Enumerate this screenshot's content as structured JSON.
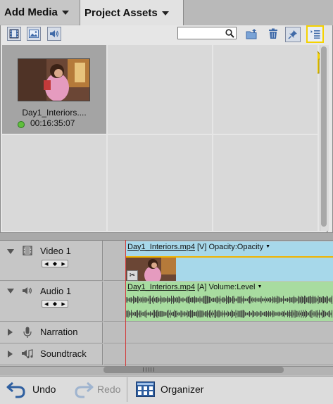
{
  "tabs": {
    "add_media": "Add Media",
    "project_assets": "Project Assets"
  },
  "toolbar": {
    "search_placeholder": ""
  },
  "assets": [
    {
      "name": "Day1_Interiors....",
      "duration": "00:16:35:07"
    }
  ],
  "timeline": {
    "tracks": [
      {
        "name": "Video 1"
      },
      {
        "name": "Audio 1"
      },
      {
        "name": "Narration"
      },
      {
        "name": "Soundtrack"
      }
    ],
    "video_clip": {
      "file": "Day1_Interiors.mp4",
      "tag": "[V]",
      "effect": "Opacity:Opacity"
    },
    "audio_clip": {
      "file": "Day1_Interiors.mp4",
      "tag": "[A]",
      "effect": "Volume:Level"
    }
  },
  "bottom": {
    "undo": "Undo",
    "redo": "Redo",
    "organizer": "Organizer"
  },
  "colors": {
    "highlight": "#f5d200",
    "video_clip": "#a7d8ea",
    "audio_clip": "#a8dca0",
    "playhead": "#d23a3a"
  }
}
